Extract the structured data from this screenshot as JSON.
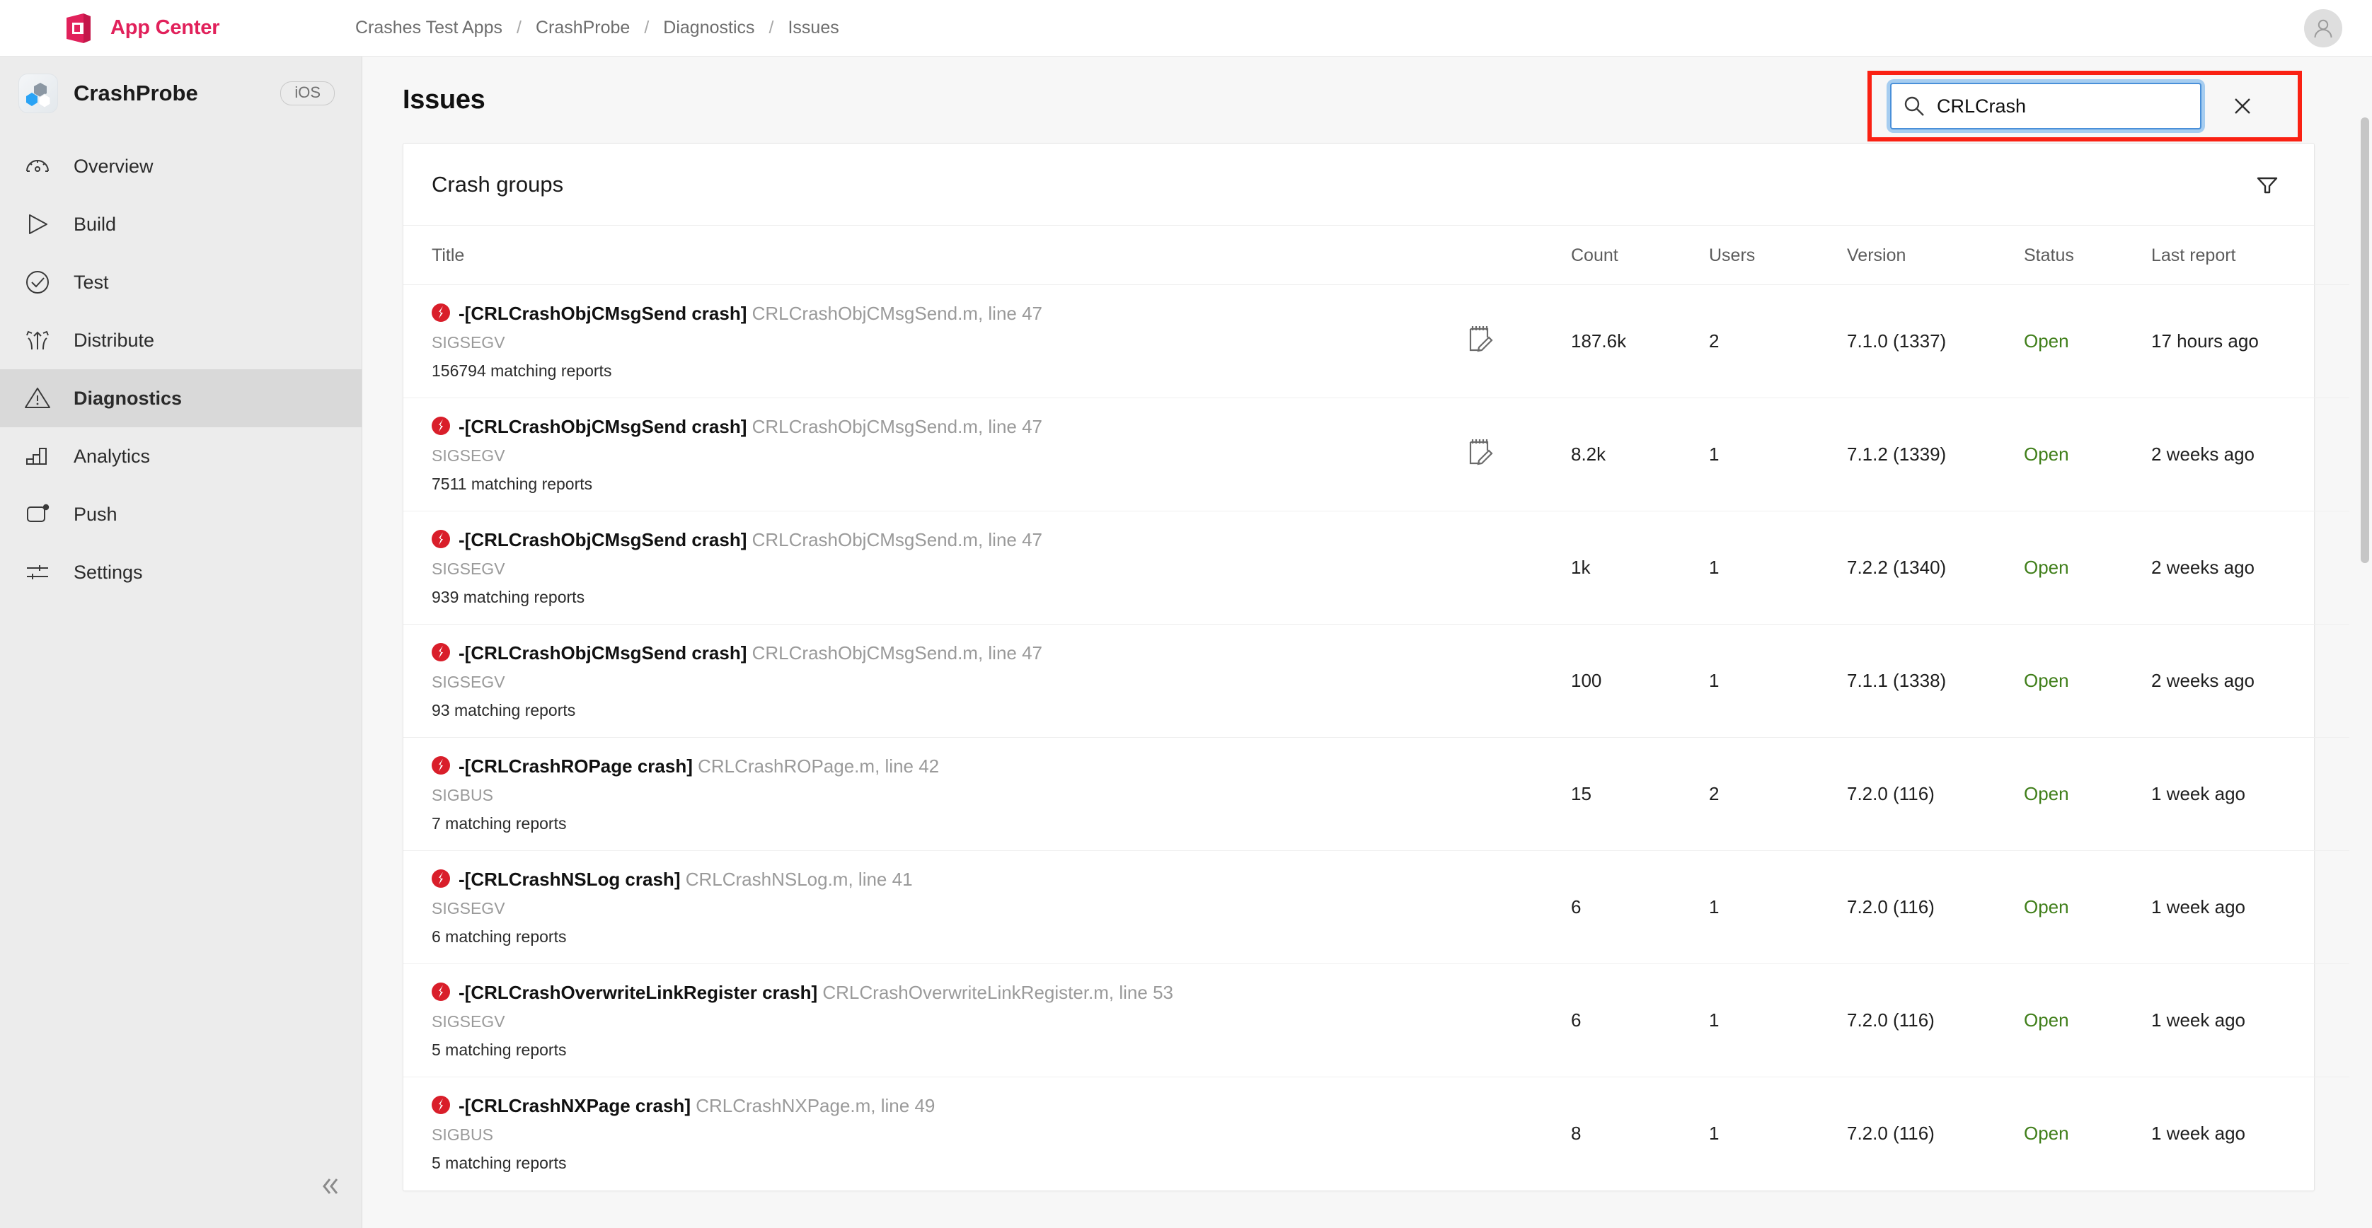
{
  "topbar": {
    "brand": "App Center",
    "brand_color": "#e1215b",
    "logo_icon": "app-center-logo-icon",
    "avatar_icon": "user-avatar-icon",
    "breadcrumb": [
      {
        "label": "Crashes Test Apps"
      },
      {
        "label": "CrashProbe"
      },
      {
        "label": "Diagnostics"
      },
      {
        "label": "Issues"
      }
    ],
    "breadcrumb_separator": "/"
  },
  "sidebar": {
    "app_name": "CrashProbe",
    "os_badge": "iOS",
    "app_icon": "crashprobe-app-icon",
    "collapse_icon": "chevron-double-left-icon",
    "items": [
      {
        "label": "Overview",
        "icon": "gauge-icon",
        "active": false
      },
      {
        "label": "Build",
        "icon": "play-icon",
        "active": false
      },
      {
        "label": "Test",
        "icon": "check-circle-icon",
        "active": false
      },
      {
        "label": "Distribute",
        "icon": "distribute-icon",
        "active": false
      },
      {
        "label": "Diagnostics",
        "icon": "warning-triangle-icon",
        "active": true
      },
      {
        "label": "Analytics",
        "icon": "bar-chart-icon",
        "active": false
      },
      {
        "label": "Push",
        "icon": "push-notification-icon",
        "active": false
      },
      {
        "label": "Settings",
        "icon": "sliders-icon",
        "active": false
      }
    ]
  },
  "page": {
    "title": "Issues"
  },
  "search": {
    "value": "CRLCrash",
    "placeholder": "Search",
    "search_icon": "search-icon",
    "clear_icon": "close-icon",
    "highlight_color": "#fa2113",
    "focus_color": "#4a90d9"
  },
  "card": {
    "title": "Crash groups",
    "filter_icon": "filter-icon",
    "note_icon": "note-edit-icon",
    "columns": [
      {
        "key": "title",
        "label": "Title"
      },
      {
        "key": "note",
        "label": ""
      },
      {
        "key": "count",
        "label": "Count"
      },
      {
        "key": "users",
        "label": "Users"
      },
      {
        "key": "version",
        "label": "Version"
      },
      {
        "key": "status",
        "label": "Status"
      },
      {
        "key": "last",
        "label": "Last report"
      }
    ],
    "status_open_color": "#3f7e19",
    "rows": [
      {
        "title_bold": "-[CRLCrashObjCMsgSend crash]",
        "title_file": "CRLCrashObjCMsgSend.m, line 47",
        "signal": "SIGSEGV",
        "matching": "156794 matching reports",
        "has_note": true,
        "count": "187.6k",
        "users": "2",
        "version": "7.1.0 (1337)",
        "status": "Open",
        "last": "17 hours ago"
      },
      {
        "title_bold": "-[CRLCrashObjCMsgSend crash]",
        "title_file": "CRLCrashObjCMsgSend.m, line 47",
        "signal": "SIGSEGV",
        "matching": "7511 matching reports",
        "has_note": true,
        "count": "8.2k",
        "users": "1",
        "version": "7.1.2 (1339)",
        "status": "Open",
        "last": "2 weeks ago"
      },
      {
        "title_bold": "-[CRLCrashObjCMsgSend crash]",
        "title_file": "CRLCrashObjCMsgSend.m, line 47",
        "signal": "SIGSEGV",
        "matching": "939 matching reports",
        "has_note": false,
        "count": "1k",
        "users": "1",
        "version": "7.2.2 (1340)",
        "status": "Open",
        "last": "2 weeks ago"
      },
      {
        "title_bold": "-[CRLCrashObjCMsgSend crash]",
        "title_file": "CRLCrashObjCMsgSend.m, line 47",
        "signal": "SIGSEGV",
        "matching": "93 matching reports",
        "has_note": false,
        "count": "100",
        "users": "1",
        "version": "7.1.1 (1338)",
        "status": "Open",
        "last": "2 weeks ago"
      },
      {
        "title_bold": "-[CRLCrashROPage crash]",
        "title_file": "CRLCrashROPage.m, line 42",
        "signal": "SIGBUS",
        "matching": "7 matching reports",
        "has_note": false,
        "count": "15",
        "users": "2",
        "version": "7.2.0 (116)",
        "status": "Open",
        "last": "1 week ago"
      },
      {
        "title_bold": "-[CRLCrashNSLog crash]",
        "title_file": "CRLCrashNSLog.m, line 41",
        "signal": "SIGSEGV",
        "matching": "6 matching reports",
        "has_note": false,
        "count": "6",
        "users": "1",
        "version": "7.2.0 (116)",
        "status": "Open",
        "last": "1 week ago"
      },
      {
        "title_bold": "-[CRLCrashOverwriteLinkRegister crash]",
        "title_file": "CRLCrashOverwriteLinkRegister.m, line 53",
        "signal": "SIGSEGV",
        "matching": "5 matching reports",
        "has_note": false,
        "count": "6",
        "users": "1",
        "version": "7.2.0 (116)",
        "status": "Open",
        "last": "1 week ago"
      },
      {
        "title_bold": "-[CRLCrashNXPage crash]",
        "title_file": "CRLCrashNXPage.m, line 49",
        "signal": "SIGBUS",
        "matching": "5 matching reports",
        "has_note": false,
        "count": "8",
        "users": "1",
        "version": "7.2.0 (116)",
        "status": "Open",
        "last": "1 week ago"
      }
    ]
  }
}
